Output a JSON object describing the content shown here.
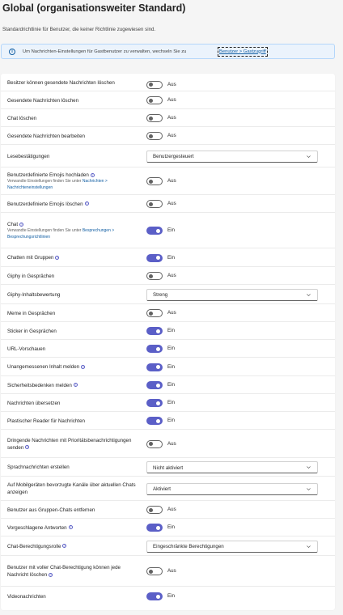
{
  "page": {
    "title": "Global (organisationsweiter Standard)",
    "subtitle": "Standardrichtlinie für Benutzer, die keiner Richtlinie zugewiesen sind.",
    "banner": {
      "text": "Um Nachrichten-Einstellungen für Gastbenutzer zu verwalten, wechseln Sie zu",
      "link": "Benutzer > Gastzugriff"
    }
  },
  "toggle_labels": {
    "on": "Ein",
    "off": "Aus"
  },
  "colors": {
    "accent": "#5b5fc7",
    "link": "#115ea3",
    "banner_bg": "#ebf3fc"
  },
  "settings": [
    {
      "label": "Besitzer können gesendete Nachrichten löschen",
      "type": "toggle",
      "on": false,
      "state": "Aus"
    },
    {
      "label": "Gesendete Nachrichten löschen",
      "type": "toggle",
      "on": false,
      "state": "Aus"
    },
    {
      "label": "Chat löschen",
      "type": "toggle",
      "on": false,
      "state": "Aus"
    },
    {
      "label": "Gesendete Nachrichten bearbeiten",
      "type": "toggle",
      "on": false,
      "state": "Aus"
    },
    {
      "label": "Lesebestätigungen",
      "type": "dropdown",
      "value": "Benutzergesteuert"
    },
    {
      "label": "Benutzerdefinierte Emojis hochladen",
      "info": true,
      "type": "toggle",
      "on": false,
      "state": "Aus",
      "sub_text": "Verwandte Einstellungen finden Sie unter",
      "sub_link": "Nachrichten > Nachrichteneinstellungen"
    },
    {
      "label": "Benutzerdefinierte Emojis löschen",
      "info": true,
      "type": "toggle",
      "on": false,
      "state": "Aus"
    },
    {
      "label": "Chat",
      "info": true,
      "type": "toggle",
      "on": true,
      "state": "Ein",
      "sub_text": "Verwandte Einstellungen finden Sie unter",
      "sub_link": "Besprechungen > Besprechungsrichtlinien"
    },
    {
      "label": "Chatten mit Gruppen",
      "info": true,
      "type": "toggle",
      "on": true,
      "state": "Ein"
    },
    {
      "label": "Giphy in Gesprächen",
      "type": "toggle",
      "on": false,
      "state": "Aus"
    },
    {
      "label": "Giphy-Inhaltsbewertung",
      "type": "dropdown",
      "value": "Streng"
    },
    {
      "label": "Meme in Gesprächen",
      "type": "toggle",
      "on": false,
      "state": "Aus"
    },
    {
      "label": "Sticker in Gesprächen",
      "type": "toggle",
      "on": true,
      "state": "Ein"
    },
    {
      "label": "URL-Vorschauen",
      "type": "toggle",
      "on": true,
      "state": "Ein"
    },
    {
      "label": "Unangemessenen Inhalt melden",
      "info": true,
      "type": "toggle",
      "on": true,
      "state": "Ein"
    },
    {
      "label": "Sicherheitsbedenken melden",
      "info": true,
      "type": "toggle",
      "on": true,
      "state": "Ein"
    },
    {
      "label": "Nachrichten übersetzen",
      "type": "toggle",
      "on": true,
      "state": "Ein"
    },
    {
      "label": "Plastischer Reader für Nachrichten",
      "type": "toggle",
      "on": true,
      "state": "Ein"
    },
    {
      "label": "Dringende Nachrichten mit Prioritätsbenachrichtigungen senden",
      "info": true,
      "type": "toggle",
      "on": false,
      "state": "Aus"
    },
    {
      "label": "Sprachnachrichten erstellen",
      "type": "dropdown",
      "value": "Nicht aktiviert"
    },
    {
      "label": "Auf Mobilgeräten bevorzugte Kanäle über aktuellen Chats anzeigen",
      "type": "dropdown",
      "value": "Aktiviert"
    },
    {
      "label": "Benutzer aus Gruppen-Chats entfernen",
      "type": "toggle",
      "on": false,
      "state": "Aus"
    },
    {
      "label": "Vorgeschlagene Antworten",
      "info": true,
      "type": "toggle",
      "on": true,
      "state": "Ein"
    },
    {
      "label": "Chat-Berechtigungsrolle",
      "info": true,
      "type": "dropdown",
      "value": "Eingeschränkte Berechtigungen"
    },
    {
      "label": "Benutzer mit voller Chat-Berechtigung können jede Nachricht löschen",
      "info": true,
      "type": "toggle",
      "on": false,
      "state": "Aus"
    },
    {
      "label": "Videonachrichten",
      "type": "toggle",
      "on": true,
      "state": "Ein"
    }
  ]
}
